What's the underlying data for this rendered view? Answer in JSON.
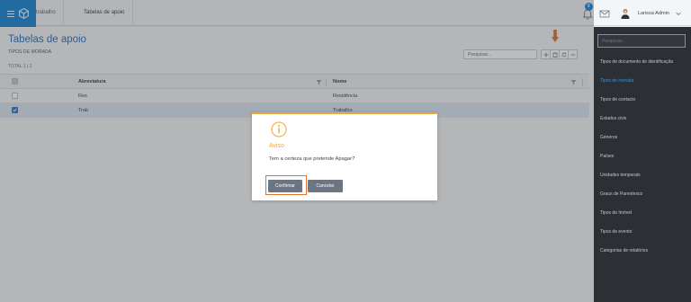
{
  "topbar": {
    "breadcrumb_1": "trabalho",
    "breadcrumb_2": "Tabelas de apoio",
    "notification_count": "0",
    "user_name": "Larissa Admin"
  },
  "page": {
    "title": "Tabelas de apoio",
    "subtitle": "TIPOS DE MORADA",
    "total": "TOTAL 1 | 2",
    "search_placeholder": "Pesquisar..."
  },
  "table": {
    "columns": [
      "Abreviatura",
      "Nome"
    ],
    "rows": [
      {
        "abreviatura": "Res",
        "nome": "Residência",
        "checked": false
      },
      {
        "abreviatura": "Trab",
        "nome": "Trabalho",
        "checked": true
      }
    ]
  },
  "modal": {
    "title": "Aviso",
    "message": "Tem a certeza que pretende Apagar?",
    "confirm_label": "Confirmar",
    "cancel_label": "Cancelar",
    "accent_color": "#f0a832"
  },
  "rightpanel": {
    "search_placeholder": "Pesquisar...",
    "items": [
      "Tipos de documento de identificação",
      "Tipos de morada",
      "Tipos de contacto",
      "Estados civis",
      "Géneros",
      "Países",
      "Unidades temporais",
      "Graus de Parentesco",
      "Tipos de Imóvel",
      "Tipos de evento",
      "Categorias de relatórios"
    ],
    "active_index": 1
  },
  "colors": {
    "brand": "#1f8ad6",
    "title": "#2f77b9",
    "highlight": "#e0752a",
    "panel_bg": "#2c3035"
  },
  "icons": {
    "menu": "hamburger-icon",
    "logo": "cube-logo-icon",
    "bell": "bell-icon",
    "mail": "mail-icon",
    "add": "plus-icon",
    "delete": "trash-icon",
    "refresh": "refresh-icon",
    "more": "more-icon",
    "filter": "filter-icon",
    "info": "info-icon"
  }
}
